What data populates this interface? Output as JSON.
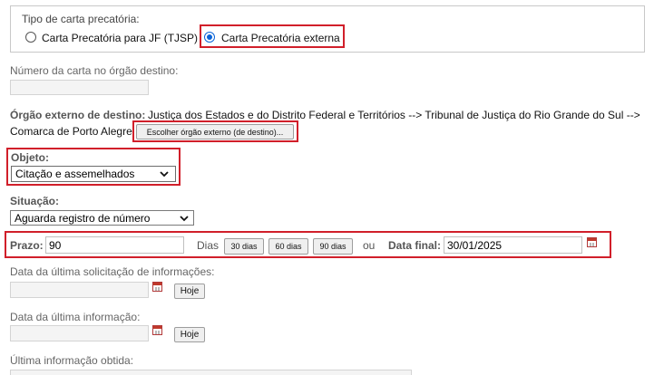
{
  "tipo": {
    "legend": "Tipo de carta precatória:",
    "option_jf": "Carta Precatória para JF (TJSP)",
    "option_externa": "Carta Precatória externa",
    "selected": "externa"
  },
  "numero_carta": {
    "label": "Número da carta no órgão destino:",
    "value": ""
  },
  "orgao": {
    "label": "Órgão externo de destino:",
    "value_line1": "Justiça dos Estados e do Distrito Federal e Territórios --> Tribunal de Justiça do Rio Grande do Sul -->",
    "value_line2": "Comarca de Porto Alegre",
    "choose_button": "Escolher órgão externo (de destino)..."
  },
  "objeto": {
    "label": "Objeto:",
    "value": "Citação e assemelhados"
  },
  "situacao": {
    "label": "Situação:",
    "value": "Aguarda registro de número"
  },
  "prazo": {
    "label": "Prazo:",
    "value": "90",
    "unit": "Dias",
    "btn_30": "30 dias",
    "btn_60": "60 dias",
    "btn_90": "90 dias",
    "ou": "ou",
    "data_final_label": "Data final:",
    "data_final_value": "30/01/2025"
  },
  "ultima_solicitacao": {
    "label": "Data da última solicitação de informações:",
    "value": "",
    "hoje": "Hoje"
  },
  "ultima_informacao": {
    "label": "Data da última informação:",
    "value": "",
    "hoje": "Hoje"
  },
  "ultima_obtida": {
    "label": "Última informação obtida:"
  },
  "colors": {
    "highlight": "#d11f2a",
    "radio_selected": "#0a64d8"
  }
}
